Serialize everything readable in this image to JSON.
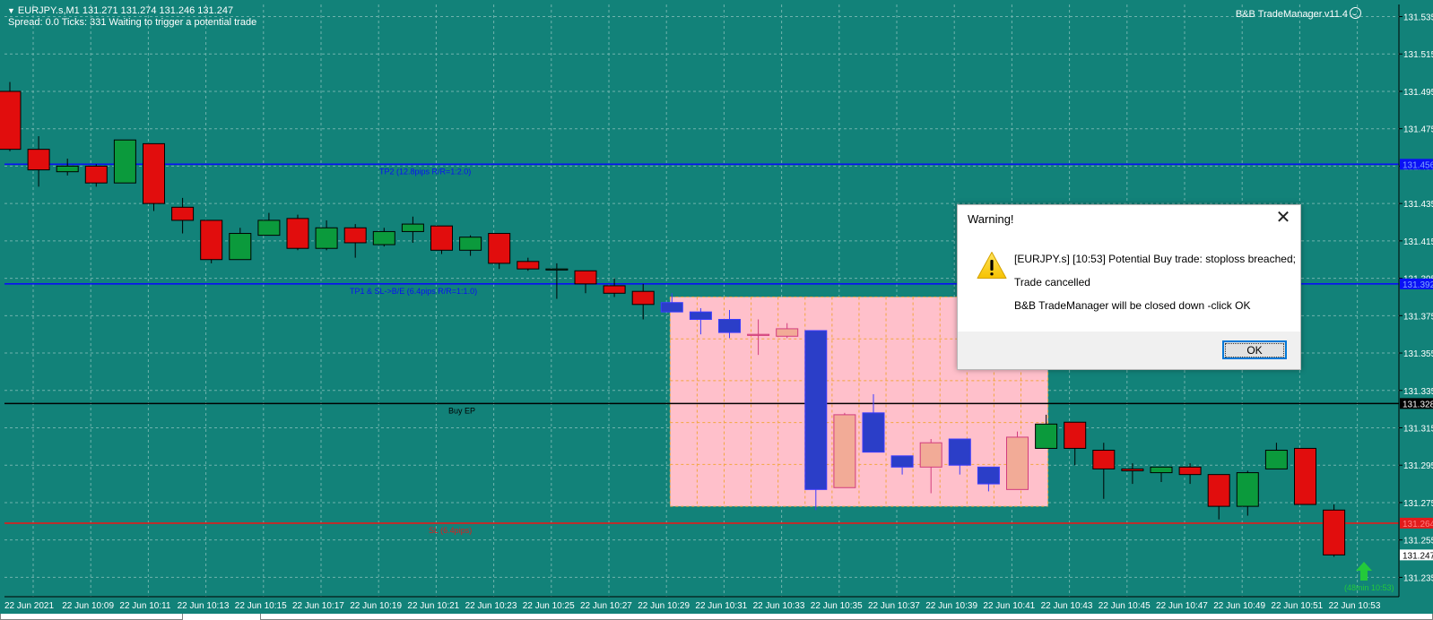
{
  "header": {
    "symbol_line": "EURJPY.s,M1  131.271 131.274 131.246 131.247",
    "status_line": "Spread: 0.0  Ticks: 331  Waiting to trigger a potential trade",
    "ea_name": "B&B TradeManager.v11.4"
  },
  "colors": {
    "background": "#128279",
    "grid": "#6fb3ad",
    "bull": "#0b9a3c",
    "bear": "#e10d0d",
    "zone_fill": "#ffc0cb",
    "zone_bull": "#f2ab97",
    "zone_bear": "#2b3ec8",
    "tp_line": "#0a10f5",
    "ep_line": "#000000",
    "sl_line": "#e21b1b"
  },
  "price_axis": {
    "labels": [
      "131.535",
      "131.515",
      "131.495",
      "131.475",
      "131.455",
      "131.435",
      "131.415",
      "131.395",
      "131.375",
      "131.355",
      "131.335",
      "131.315",
      "131.295",
      "131.275",
      "131.255",
      "131.235"
    ]
  },
  "time_axis": {
    "labels": [
      "22 Jun 2021",
      "22 Jun 10:09",
      "22 Jun 10:11",
      "22 Jun 10:13",
      "22 Jun 10:15",
      "22 Jun 10:17",
      "22 Jun 10:19",
      "22 Jun 10:21",
      "22 Jun 10:23",
      "22 Jun 10:25",
      "22 Jun 10:27",
      "22 Jun 10:29",
      "22 Jun 10:31",
      "22 Jun 10:33",
      "22 Jun 10:35",
      "22 Jun 10:37",
      "22 Jun 10:39",
      "22 Jun 10:41",
      "22 Jun 10:43",
      "22 Jun 10:45",
      "22 Jun 10:47",
      "22 Jun 10:49",
      "22 Jun 10:51",
      "22 Jun 10:53"
    ]
  },
  "levels": [
    {
      "label": "TP2 (12.8pips R/R=1:2.0)",
      "price": 131.456,
      "tag": "131.456",
      "kind": "tp"
    },
    {
      "label": "TP1 & SL->B/E (6.4pips R/R=1:1.0)",
      "price": 131.392,
      "tag": "131.392",
      "kind": "tp"
    },
    {
      "label": "Buy EP",
      "price": 131.328,
      "tag": "131.328",
      "kind": "ep"
    },
    {
      "label": "SL (6.4pips)",
      "price": 131.264,
      "tag": "131.264",
      "kind": "sl"
    }
  ],
  "current_price": {
    "tag": "131.247",
    "price": 131.247
  },
  "signal": {
    "label": "(48min 10:53)"
  },
  "dialog": {
    "title": "Warning!",
    "close_label": "✕",
    "message_1": "[EURJPY.s] [10:53] Potential Buy trade: stoploss breached;",
    "message_2": "Trade cancelled",
    "message_3": "B&B TradeManager will be closed down -click OK",
    "ok_label": "OK"
  },
  "chart_data": {
    "type": "candlestick",
    "y_range": [
      131.228,
      131.541
    ],
    "zone": {
      "from_index": 23,
      "to_index": 36,
      "high": 131.385,
      "low": 131.273
    },
    "candles": [
      {
        "o": 131.495,
        "h": 131.5,
        "l": 131.463,
        "c": 131.464
      },
      {
        "o": 131.464,
        "h": 131.471,
        "l": 131.444,
        "c": 131.453
      },
      {
        "o": 131.452,
        "h": 131.459,
        "l": 131.45,
        "c": 131.455
      },
      {
        "o": 131.455,
        "h": 131.456,
        "l": 131.444,
        "c": 131.446
      },
      {
        "o": 131.446,
        "h": 131.469,
        "l": 131.446,
        "c": 131.469
      },
      {
        "o": 131.467,
        "h": 131.467,
        "l": 131.431,
        "c": 131.435
      },
      {
        "o": 131.433,
        "h": 131.438,
        "l": 131.419,
        "c": 131.426
      },
      {
        "o": 131.426,
        "h": 131.426,
        "l": 131.403,
        "c": 131.405
      },
      {
        "o": 131.405,
        "h": 131.422,
        "l": 131.405,
        "c": 131.419
      },
      {
        "o": 131.418,
        "h": 131.43,
        "l": 131.418,
        "c": 131.426
      },
      {
        "o": 131.427,
        "h": 131.429,
        "l": 131.41,
        "c": 131.411
      },
      {
        "o": 131.411,
        "h": 131.426,
        "l": 131.41,
        "c": 131.422
      },
      {
        "o": 131.422,
        "h": 131.424,
        "l": 131.406,
        "c": 131.414
      },
      {
        "o": 131.413,
        "h": 131.422,
        "l": 131.412,
        "c": 131.42
      },
      {
        "o": 131.42,
        "h": 131.428,
        "l": 131.414,
        "c": 131.424
      },
      {
        "o": 131.423,
        "h": 131.423,
        "l": 131.408,
        "c": 131.41
      },
      {
        "o": 131.41,
        "h": 131.418,
        "l": 131.407,
        "c": 131.417
      },
      {
        "o": 131.419,
        "h": 131.419,
        "l": 131.4,
        "c": 131.403
      },
      {
        "o": 131.404,
        "h": 131.406,
        "l": 131.399,
        "c": 131.4
      },
      {
        "o": 131.4,
        "h": 131.403,
        "l": 131.384,
        "c": 131.4
      },
      {
        "o": 131.399,
        "h": 131.399,
        "l": 131.387,
        "c": 131.392
      },
      {
        "o": 131.391,
        "h": 131.395,
        "l": 131.385,
        "c": 131.387
      },
      {
        "o": 131.388,
        "h": 131.392,
        "l": 131.373,
        "c": 131.381
      },
      {
        "o": 131.382,
        "h": 131.387,
        "l": 131.377,
        "c": 131.377
      },
      {
        "o": 131.377,
        "h": 131.379,
        "l": 131.365,
        "c": 131.373
      },
      {
        "o": 131.373,
        "h": 131.378,
        "l": 131.363,
        "c": 131.366
      },
      {
        "o": 131.365,
        "h": 131.373,
        "l": 131.354,
        "c": 131.365
      },
      {
        "o": 131.364,
        "h": 131.371,
        "l": 131.363,
        "c": 131.368
      },
      {
        "o": 131.367,
        "h": 131.367,
        "l": 131.271,
        "c": 131.282
      },
      {
        "o": 131.283,
        "h": 131.323,
        "l": 131.283,
        "c": 131.322
      },
      {
        "o": 131.323,
        "h": 131.333,
        "l": 131.302,
        "c": 131.302
      },
      {
        "o": 131.3,
        "h": 131.3,
        "l": 131.29,
        "c": 131.294
      },
      {
        "o": 131.294,
        "h": 131.309,
        "l": 131.28,
        "c": 131.307
      },
      {
        "o": 131.309,
        "h": 131.309,
        "l": 131.29,
        "c": 131.295
      },
      {
        "o": 131.294,
        "h": 131.294,
        "l": 131.281,
        "c": 131.285
      },
      {
        "o": 131.282,
        "h": 131.313,
        "l": 131.282,
        "c": 131.31
      },
      {
        "o": 131.304,
        "h": 131.322,
        "l": 131.304,
        "c": 131.317
      },
      {
        "o": 131.318,
        "h": 131.318,
        "l": 131.295,
        "c": 131.304
      },
      {
        "o": 131.303,
        "h": 131.307,
        "l": 131.277,
        "c": 131.293
      },
      {
        "o": 131.293,
        "h": 131.296,
        "l": 131.285,
        "c": 131.292
      },
      {
        "o": 131.291,
        "h": 131.294,
        "l": 131.286,
        "c": 131.294
      },
      {
        "o": 131.294,
        "h": 131.296,
        "l": 131.285,
        "c": 131.29
      },
      {
        "o": 131.29,
        "h": 131.29,
        "l": 131.266,
        "c": 131.273
      },
      {
        "o": 131.273,
        "h": 131.292,
        "l": 131.268,
        "c": 131.291
      },
      {
        "o": 131.293,
        "h": 131.307,
        "l": 131.293,
        "c": 131.303
      },
      {
        "o": 131.304,
        "h": 131.304,
        "l": 131.274,
        "c": 131.274
      },
      {
        "o": 131.271,
        "h": 131.274,
        "l": 131.246,
        "c": 131.247
      }
    ]
  }
}
